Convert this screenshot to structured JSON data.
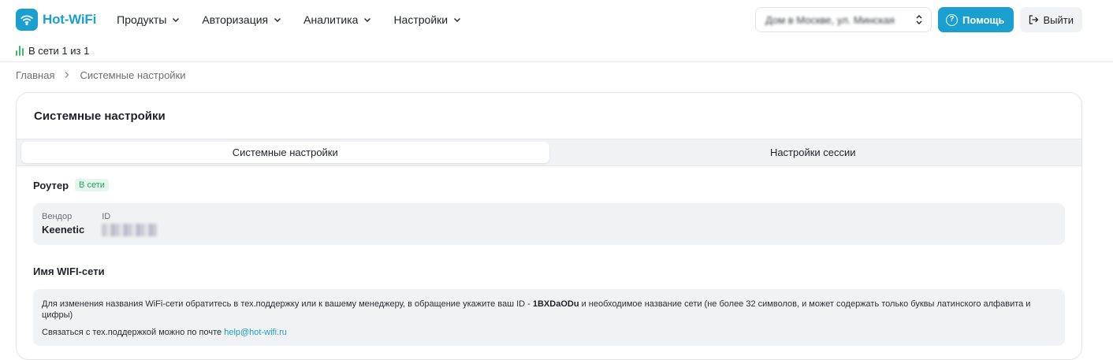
{
  "header": {
    "logo_text": "Hot-WiFi",
    "nav": [
      {
        "label": "Продукты"
      },
      {
        "label": "Авторизация"
      },
      {
        "label": "Аналитика"
      },
      {
        "label": "Настройки"
      }
    ],
    "location": "Дом в Москве, ул. Минская",
    "help_label": "Помощь",
    "logout_label": "Выйти",
    "accent_color": "#1a9fd0"
  },
  "status": {
    "text": "В сети 1 из 1",
    "color": "#3fb86a"
  },
  "breadcrumb": {
    "home": "Главная",
    "current": "Системные настройки"
  },
  "card": {
    "title": "Системные настройки",
    "tabs": [
      {
        "label": "Системные настройки",
        "active": true
      },
      {
        "label": "Настройки сессии",
        "active": false
      }
    ],
    "router": {
      "title": "Роутер",
      "status_badge": "В сети",
      "vendor_label": "Вендор",
      "vendor_value": "Keenetic",
      "id_label": "ID"
    },
    "wifi": {
      "title": "Имя WIFI-сети",
      "info_prefix": "Для изменения названия WiFi-сети обратитесь в тех.поддержку или к вашему менеджеру, в обращение укажите ваш ID -",
      "info_id": "1BXDaODu",
      "info_suffix": "и необходимое название сети (не более 32 символов, и может содержать только буквы латинского алфавита и цифры)",
      "contact_prefix": "Связаться с тех.поддержкой можно по почте",
      "contact_email": "help@hot-wifi.ru"
    }
  }
}
